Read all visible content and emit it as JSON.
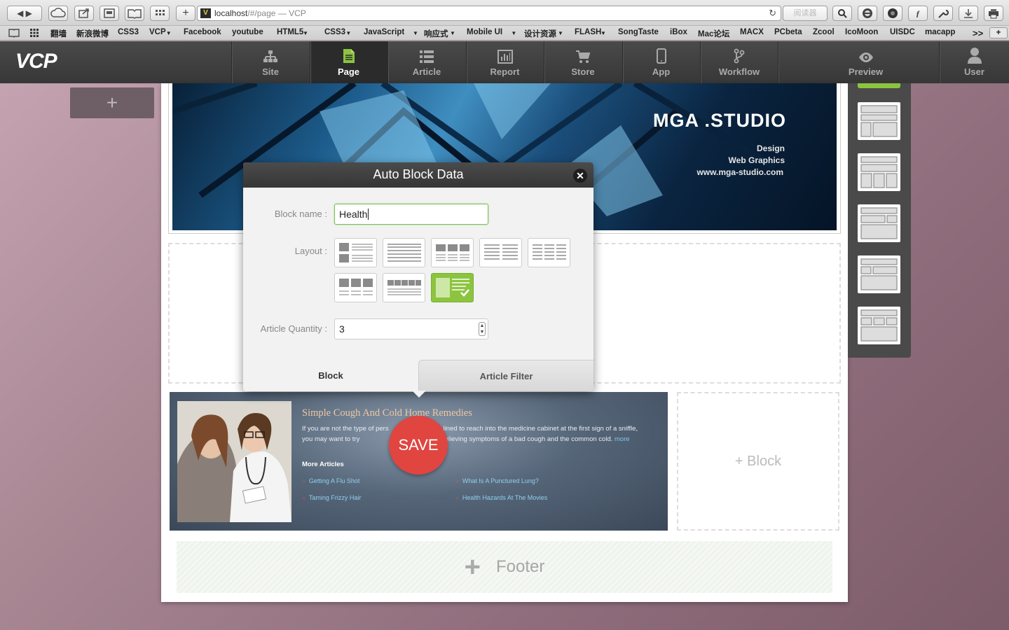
{
  "browser": {
    "url_host": "localhost",
    "url_path": "/#/page",
    "page_title": "— VCP",
    "reader_label": "阅读器",
    "bookmarks": [
      {
        "label": "新浪微博",
        "dropdown": false
      },
      {
        "label": "CSS3",
        "dropdown": false
      },
      {
        "label": "VCP",
        "dropdown": true
      },
      {
        "label": "Facebook",
        "dropdown": false
      },
      {
        "label": "youtube",
        "dropdown": false
      },
      {
        "label": "HTML5",
        "dropdown": true
      },
      {
        "label": "CSS3",
        "dropdown": true
      },
      {
        "label": "JavaScript",
        "dropdown": true
      },
      {
        "label": "响应式",
        "dropdown": true
      },
      {
        "label": "Mobile UI",
        "dropdown": true
      },
      {
        "label": "设计资源",
        "dropdown": true
      },
      {
        "label": "FLASH",
        "dropdown": true
      },
      {
        "label": "SongTaste",
        "dropdown": false
      },
      {
        "label": "iBox",
        "dropdown": false
      },
      {
        "label": "Mac论坛",
        "dropdown": false
      },
      {
        "label": "MACX",
        "dropdown": false
      },
      {
        "label": "PCbeta",
        "dropdown": false
      },
      {
        "label": "Zcool",
        "dropdown": false
      },
      {
        "label": "IcoMoon",
        "dropdown": false
      },
      {
        "label": "UISDC",
        "dropdown": false
      },
      {
        "label": "macapp",
        "dropdown": false
      }
    ],
    "bookmark_first": "翻墙",
    "bookmark_overflow": ">>"
  },
  "app": {
    "logo": "VCP",
    "nav": [
      {
        "label": "Site",
        "icon": "sitemap-icon",
        "active": false
      },
      {
        "label": "Page",
        "icon": "page-icon",
        "active": true
      },
      {
        "label": "Article",
        "icon": "list-icon",
        "active": false
      },
      {
        "label": "Report",
        "icon": "chart-icon",
        "active": false
      },
      {
        "label": "Store",
        "icon": "cart-icon",
        "active": false
      },
      {
        "label": "App",
        "icon": "mobile-icon",
        "active": false
      },
      {
        "label": "Workflow",
        "icon": "branch-icon",
        "active": false
      }
    ],
    "preview_label": "Preview",
    "user_label": "User"
  },
  "canvas": {
    "left_add": "+",
    "banner": {
      "title": "MGA .STUDIO",
      "line1": "Design",
      "line2": "Web Graphics",
      "line3": "www.mga-studio.com"
    },
    "article": {
      "title": "Simple Cough And Cold Home Remedies",
      "body_a": "If you are not the type of pers",
      "body_b": "lined to reach into the medicine cabinet at the first sign of a sniffle, you may want to try ",
      "body_c": "remedies for relieving symptoms of a bad cough and the common cold. ",
      "more_link": "more",
      "more_articles": "More Articles",
      "links": [
        "Getting A Flu Shot",
        "What Is A Punctured Lung?",
        "Taming Frizzy Hair",
        "Health Hazards At The Movies"
      ]
    },
    "add_block": "+ Block",
    "footer": "Footer",
    "save": "SAVE"
  },
  "modal": {
    "title": "Auto Block Data",
    "block_name_label": "Block name :",
    "block_name_value": "Health",
    "layout_label": "Layout :",
    "selected_layout_index": 7,
    "article_qty_label": "Article Quantity :",
    "article_qty_value": "3",
    "tab_block": "Block",
    "tab_filter": "Article Filter"
  },
  "colors": {
    "accent_green": "#8cc43f",
    "save_red": "#e0453f",
    "nav_bg": "#404040"
  }
}
